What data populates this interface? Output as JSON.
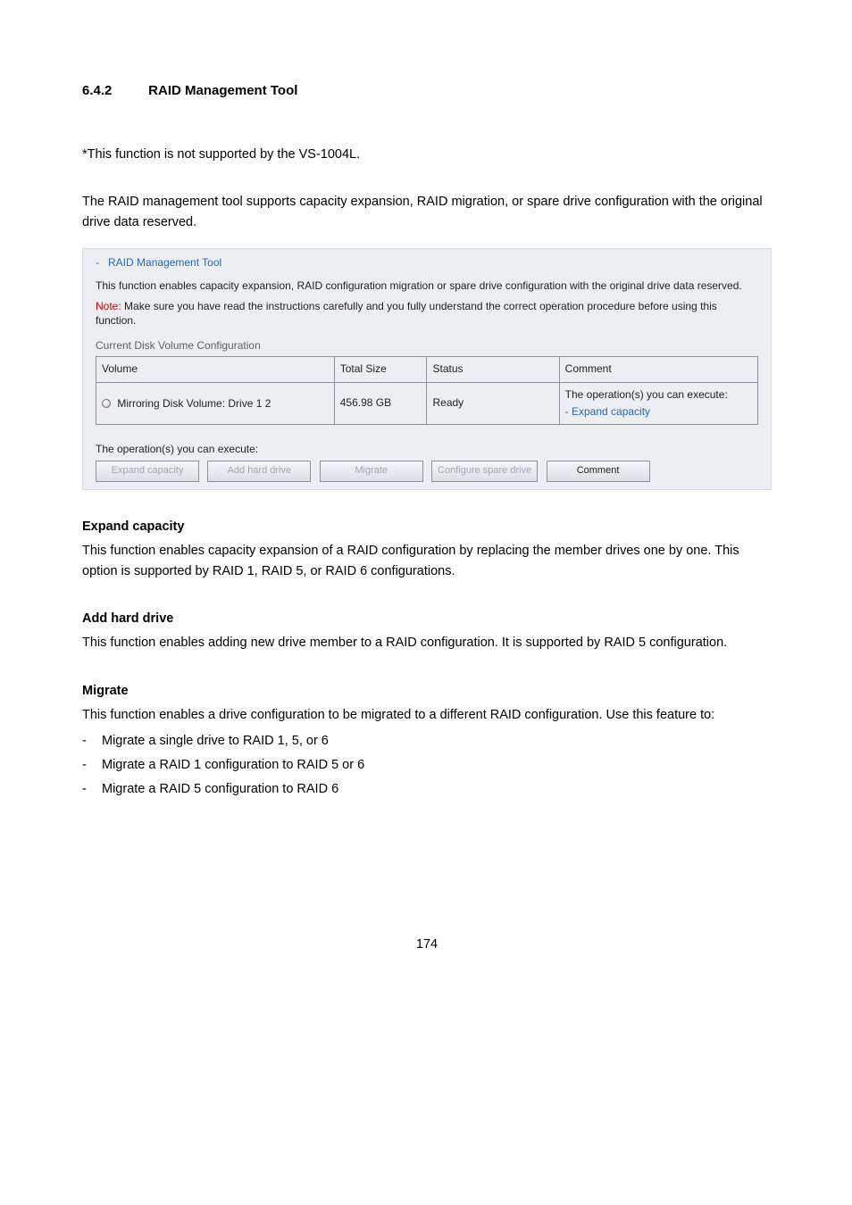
{
  "heading": {
    "number": "6.4.2",
    "title": "RAID Management Tool"
  },
  "para_not_supported": "*This function is not supported by the VS-1004L.",
  "para_intro": "The RAID management tool supports capacity expansion, RAID migration, or spare drive configuration with the original drive data reserved.",
  "ui": {
    "dash": "-",
    "title": "RAID Management Tool",
    "desc": "This function enables capacity expansion, RAID configuration migration or spare drive configuration with the original drive data reserved.",
    "note_label": "Note:",
    "note_text": " Make sure you have read the instructions carefully and you fully understand the correct operation procedure before using this function.",
    "subhead": "Current Disk Volume Configuration",
    "columns": {
      "volume": "Volume",
      "total_size": "Total Size",
      "status": "Status",
      "comment": "Comment"
    },
    "row": {
      "volume_name": "Mirroring Disk Volume: Drive 1 2",
      "total_size": "456.98 GB",
      "status": "Ready",
      "comment_plain": "The operation(s) you can execute:",
      "comment_link": "- Expand capacity"
    },
    "ops_label": "The operation(s) you can execute:",
    "buttons": {
      "expand": "Expand capacity",
      "add": "Add hard drive",
      "migrate": "Migrate",
      "spare": "Configure spare drive",
      "comment": "Comment"
    }
  },
  "sections": {
    "expand": {
      "title": "Expand capacity",
      "body": "This function enables capacity expansion of a RAID configuration by replacing the member drives one by one.   This option is supported by RAID 1, RAID 5, or RAID 6 configurations."
    },
    "add": {
      "title": "Add hard drive",
      "body": "This function enables adding new drive member to a RAID configuration.   It is supported by RAID 5 configuration."
    },
    "migrate": {
      "title": "Migrate",
      "body": "This function enables a drive configuration to be migrated to a different RAID configuration. Use this feature to:",
      "bullets": [
        "Migrate a single drive to RAID 1, 5, or 6",
        "Migrate a RAID 1 configuration to RAID 5 or 6",
        "Migrate a RAID 5 configuration to RAID 6"
      ]
    }
  },
  "page_number": "174"
}
